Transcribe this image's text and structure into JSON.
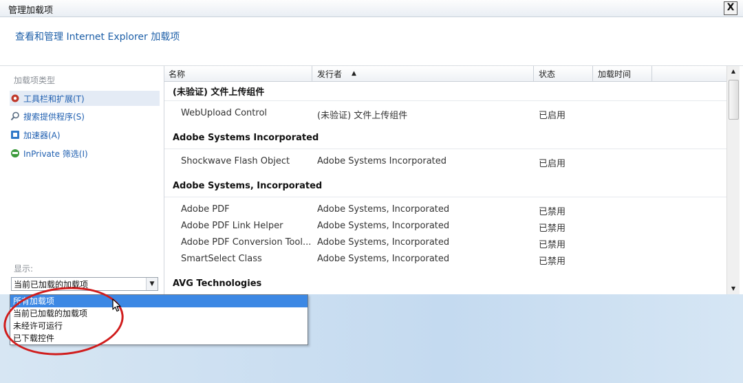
{
  "window": {
    "title": "管理加载项",
    "close_label": "X"
  },
  "header": {
    "heading": "查看和管理 Internet Explorer 加载项"
  },
  "left_panel": {
    "types_label": "加载项类型",
    "categories": [
      {
        "label": "工具栏和扩展(T)",
        "icon": "gear-icon",
        "selected": true
      },
      {
        "label": "搜索提供程序(S)",
        "icon": "search-icon",
        "selected": false
      },
      {
        "label": "加速器(A)",
        "icon": "accelerator-icon",
        "selected": false
      },
      {
        "label": "InPrivate 筛选(I)",
        "icon": "inprivate-icon",
        "selected": false
      }
    ],
    "show_label": "显示:",
    "show_value": "当前已加载的加载项"
  },
  "columns": {
    "name": "名称",
    "publisher": "发行者",
    "sort_indicator": "▲",
    "status": "状态",
    "load_time": "加载时间"
  },
  "groups": [
    {
      "header": "(未验证) 文件上传组件",
      "rows": [
        {
          "name": "WebUpload Control",
          "publisher": "(未验证) 文件上传组件",
          "status": "已启用"
        }
      ]
    },
    {
      "header": "Adobe Systems Incorporated",
      "rows": [
        {
          "name": "Shockwave Flash Object",
          "publisher": "Adobe Systems Incorporated",
          "status": "已启用"
        }
      ]
    },
    {
      "header": "Adobe Systems, Incorporated",
      "rows": [
        {
          "name": "Adobe PDF",
          "publisher": "Adobe Systems, Incorporated",
          "status": "已禁用"
        },
        {
          "name": "Adobe PDF Link Helper",
          "publisher": "Adobe Systems, Incorporated",
          "status": "已禁用"
        },
        {
          "name": "Adobe PDF Conversion Tool...",
          "publisher": "Adobe Systems, Incorporated",
          "status": "已禁用"
        },
        {
          "name": "SmartSelect Class",
          "publisher": "Adobe Systems, Incorporated",
          "status": "已禁用"
        }
      ]
    },
    {
      "header": "AVG Technologies",
      "rows": []
    }
  ],
  "dropdown": {
    "options": [
      "所有加载项",
      "当前已加载的加载项",
      "未经许可运行",
      "已下载控件"
    ],
    "highlighted_index": 0
  },
  "colors": {
    "accent": "#1d5fa8",
    "highlight": "#3c88e4",
    "annotation": "#d01c1c"
  }
}
